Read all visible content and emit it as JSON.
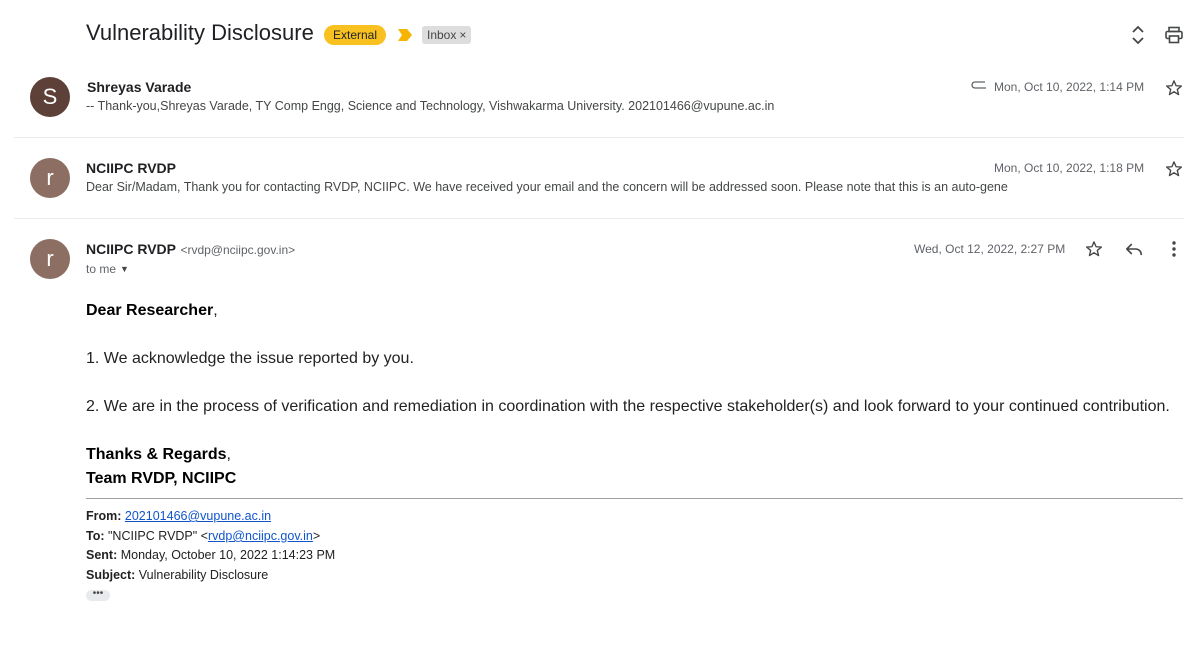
{
  "thread": {
    "subject": "Vulnerability Disclosure",
    "external_label": "External",
    "inbox_label": "Inbox",
    "inbox_remove": "×",
    "colors": {
      "external_badge": "#f9c11f",
      "importance_marker": "#f4b400",
      "inbox_badge": "#dddddd"
    }
  },
  "messages": [
    {
      "avatar_letter": "S",
      "avatar_color": "#5d4037",
      "sender": "Shreyas Varade",
      "snippet": "-- Thank-you,Shreyas Varade, TY Comp Engg, Science and Technology, Vishwakarma University. 202101466@vupune.ac.in",
      "date": "Mon, Oct 10, 2022, 1:14 PM",
      "has_attachment": true
    },
    {
      "avatar_letter": "r",
      "avatar_color": "#8d6e63",
      "sender": "NCIIPC RVDP",
      "snippet": "Dear Sir/Madam, Thank you for contacting RVDP, NCIIPC. We have received your email and the concern will be addressed soon. Please note that this is an auto-gene",
      "date": "Mon, Oct 10, 2022, 1:18 PM"
    }
  ],
  "open_message": {
    "avatar_letter": "r",
    "avatar_color": "#8d6e63",
    "sender": "NCIIPC RVDP",
    "sender_email": "<rvdp@nciipc.gov.in>",
    "to": "to me",
    "date": "Wed, Oct 12, 2022, 2:27 PM",
    "body": {
      "greeting": "Dear Researcher",
      "greeting_punct": ",",
      "line1": "1. We acknowledge the issue reported by you.",
      "line2": "2. We are in the process of verification and remediation in coordination with the respective stakeholder(s) and look forward to your continued contribution.",
      "thanks": "Thanks & Regards",
      "thanks_punct": ",",
      "team": "Team RVDP, NCIIPC"
    },
    "quoted": {
      "from_key": "From:",
      "from_value": "202101466@vupune.ac.in",
      "to_key": "To:",
      "to_prefix": " \"NCIIPC RVDP\" <",
      "to_email": "rvdp@nciipc.gov.in",
      "to_suffix": ">",
      "sent_key": "Sent:",
      "sent_value": " Monday, October 10, 2022 1:14:23 PM",
      "subject_key": "Subject:",
      "subject_value": " Vulnerability Disclosure",
      "ellipsis": "•••"
    }
  },
  "icons": {
    "importance": "importance-marker-icon",
    "expand": "expand-all-icon",
    "print": "print-icon",
    "attachment": "paperclip-icon",
    "star": "star-outline-icon",
    "reply": "reply-icon",
    "more": "more-vert-icon",
    "caret": "caret-down-icon"
  }
}
